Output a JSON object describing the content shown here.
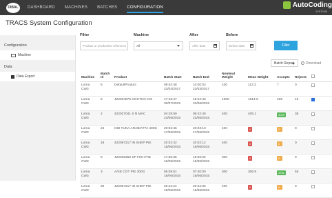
{
  "app": {
    "logo_text": "DIBAL",
    "brand": "AutoCoding",
    "brand_sub": "SYSTEMS",
    "nav": [
      "DASHBOARD",
      "MACHINES",
      "BATCHES",
      "CONFIGURATION"
    ],
    "page_title": "TRACS System Configuration"
  },
  "sidebar": {
    "sections": [
      {
        "label": "Configuration",
        "items": [
          {
            "label": "Machine"
          }
        ]
      },
      {
        "label": "Data",
        "items": [
          {
            "label": "Data Export"
          }
        ]
      }
    ]
  },
  "filters": {
    "filter_label": "Filter",
    "filter_placeholder": "Product or production reference",
    "machine_label": "Machine",
    "machine_value": "All",
    "after_label": "After",
    "after_placeholder": "After date",
    "before_label": "Before",
    "before_placeholder": "Before date",
    "filter_button": "Filter"
  },
  "actions": {
    "batch_report": "Batch Report",
    "download": "Download"
  },
  "table": {
    "columns": [
      "Machine",
      "Batch Id",
      "Product",
      "Batch Start",
      "Batch End",
      "Nominal Weight",
      "Mean Weight",
      "Accepts",
      "Rejects",
      ""
    ],
    "rows": [
      {
        "machine": "Lorna CW3",
        "batch_id": "6",
        "product": "DefaultProduct",
        "start": "09:54:48 23/03/2017",
        "end": "10:00:03 23/03/2017",
        "nominal": "100",
        "mean": "113.3",
        "accepts": "7",
        "rejects": "0",
        "checked": false,
        "shaded": false,
        "mean_badge": "",
        "accepts_badge": ""
      },
      {
        "machine": "Lorna CW3",
        "batch_id": "5",
        "product": "422004876 COSTCO CIS",
        "start": "17:18:47 30/07/2015",
        "end": "18:22:43 23/06/2015",
        "nominal": "1600",
        "mean": "1614.6",
        "accepts": "405",
        "rejects": "16",
        "checked": true,
        "shaded": false,
        "mean_badge": "",
        "accepts_badge": ""
      },
      {
        "machine": "Lorna CW3",
        "batch_id": "2",
        "product": "422027041 S N MAC",
        "start": "04:28:59 23/06/2015",
        "end": "06:42:40 23/06/2015",
        "nominal": "400",
        "mean": "405.1",
        "accepts": "3029",
        "rejects": "38",
        "checked": false,
        "shaded": true,
        "mean_badge": "",
        "accepts_badge": "green"
      },
      {
        "machine": "Lorna CW3",
        "batch_id": "24",
        "product": "IND TUNA ARABIATTA 400G",
        "start": "20:02:45 17/06/2015",
        "end": "20:03:10 17/06/2015",
        "nominal": "400",
        "mean": "0",
        "accepts": "0",
        "rejects": "0",
        "checked": false,
        "shaded": false,
        "mean_badge": "red",
        "accepts_badge": "orange"
      },
      {
        "machine": "Lorna CW3",
        "batch_id": "18",
        "product": "422097217 IN SHEP PIE",
        "start": "20:02:42 16/06/2015",
        "end": "20:02:12 16/06/2015",
        "nominal": "400",
        "mean": "0",
        "accepts": "0",
        "rejects": "0",
        "checked": false,
        "shaded": true,
        "mean_badge": "red",
        "accepts_badge": "orange"
      },
      {
        "machine": "Lorna CW3",
        "batch_id": "8",
        "product": "422035350 SP FISH PIE",
        "start": "17:55:35 16/06/2015",
        "end": "18:06:02 16/06/2015",
        "nominal": "300",
        "mean": "0",
        "accepts": "0",
        "rejects": "0",
        "checked": false,
        "shaded": false,
        "mean_badge": "red",
        "accepts_badge": "orange"
      },
      {
        "machine": "Lorna CW3",
        "batch_id": "3",
        "product": "A/SE COT PIE 300G",
        "start": "05:08:51 16/06/2015",
        "end": "07:40:00 16/06/2015",
        "nominal": "300",
        "mean": "306.9",
        "accepts": "3752",
        "rejects": "55",
        "checked": false,
        "shaded": true,
        "mean_badge": "",
        "accepts_badge": "green"
      },
      {
        "machine": "Lorna CW3",
        "batch_id": "20",
        "product": "422097217 IN SHEP PIE",
        "start": "20:22:24 15/06/2015",
        "end": "20:22:33 15/06/2015",
        "nominal": "400",
        "mean": "0",
        "accepts": "0",
        "rejects": "0",
        "checked": false,
        "shaded": false,
        "mean_badge": "red",
        "accepts_badge": "orange"
      }
    ]
  }
}
